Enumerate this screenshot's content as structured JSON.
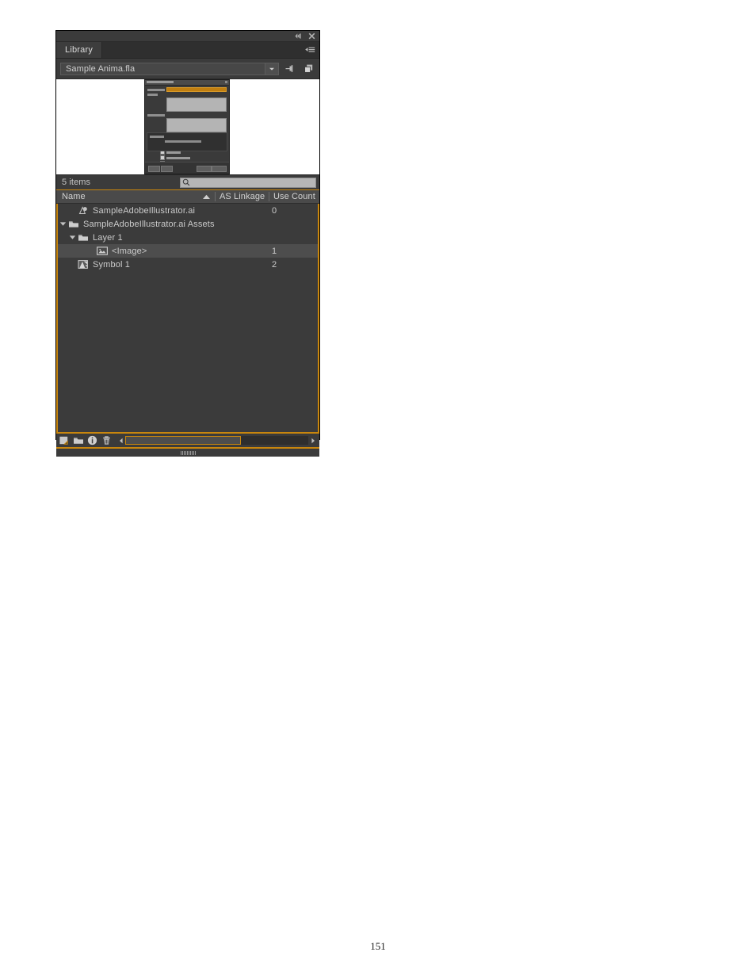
{
  "panel": {
    "titlebar": {
      "collapse_icon": "collapse-to-icons-icon",
      "close_icon": "close-icon"
    },
    "tabs": [
      {
        "label": "Library",
        "active": true
      }
    ],
    "menu_icon": "panel-menu-icon",
    "document_selector": {
      "value": "Sample Anima.fla",
      "dropdown_icon": "chevron-down-icon"
    },
    "document_buttons": [
      {
        "name": "pin-current-library-button",
        "icon": "pin-icon"
      },
      {
        "name": "new-library-panel-button",
        "icon": "duplicate-panels-icon"
      }
    ],
    "preview": {
      "name": "item-preview-area",
      "description": "thumbnail preview of selected library item"
    },
    "status": {
      "items_count": "5 items"
    },
    "search": {
      "value": "",
      "placeholder": "",
      "icon": "search-icon"
    },
    "columns": [
      {
        "key": "name",
        "label": "Name",
        "sorted": "asc",
        "sort_icon": "sort-ascending-icon"
      },
      {
        "key": "as_linkage",
        "label": "AS Linkage"
      },
      {
        "key": "use_count",
        "label": "Use Count"
      }
    ],
    "items": [
      {
        "label": "SampleAdobeIllustrator.ai",
        "icon": "graphic-symbol-icon",
        "indent": 1,
        "twisty": "none",
        "as_linkage": "",
        "use_count": "0",
        "selected": false
      },
      {
        "label": "SampleAdobeIllustrator.ai Assets",
        "icon": "folder-icon",
        "indent": 0,
        "twisty": "expanded",
        "as_linkage": "",
        "use_count": "",
        "selected": false
      },
      {
        "label": "Layer 1",
        "icon": "folder-icon",
        "indent": 1,
        "twisty": "expanded",
        "as_linkage": "",
        "use_count": "",
        "selected": false
      },
      {
        "label": "<Image>",
        "icon": "bitmap-image-icon",
        "indent": 3,
        "twisty": "none",
        "as_linkage": "",
        "use_count": "1",
        "selected": true
      },
      {
        "label": "Symbol 1",
        "icon": "movie-clip-symbol-icon",
        "indent": 1,
        "twisty": "none",
        "as_linkage": "",
        "use_count": "2",
        "selected": false
      }
    ],
    "toolbar": [
      {
        "name": "new-symbol-button",
        "icon": "new-symbol-icon"
      },
      {
        "name": "new-folder-button",
        "icon": "new-folder-icon"
      },
      {
        "name": "properties-button",
        "icon": "info-properties-icon"
      },
      {
        "name": "delete-button",
        "icon": "trash-delete-icon"
      }
    ],
    "scrollbar": {
      "left_arrow_icon": "scroll-left-arrow-icon",
      "right_arrow_icon": "scroll-right-arrow-icon"
    },
    "resize_grip": "panel-resize-grip"
  },
  "colors": {
    "panel_bg": "#3b3b3b",
    "accent_amber": "#c8860d",
    "tab_bg": "#2f2f2f",
    "header_bg": "#4a4a4a",
    "selected_row": "#4d4d4d",
    "text": "#cbcbcb",
    "search_field": "#b6b6b6"
  },
  "document": {
    "page_number": "151"
  }
}
